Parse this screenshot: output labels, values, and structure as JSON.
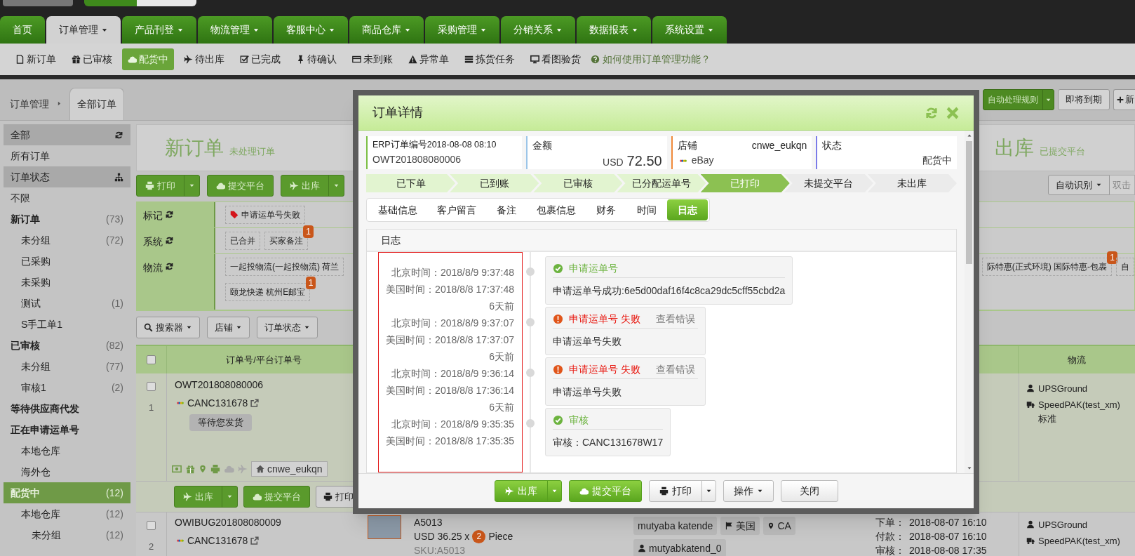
{
  "nav_tabs": [
    {
      "label": "首页",
      "dropdown": false,
      "selected": false
    },
    {
      "label": "订单管理",
      "dropdown": true,
      "selected": true
    },
    {
      "label": "产品刊登",
      "dropdown": true,
      "selected": false
    },
    {
      "label": "物流管理",
      "dropdown": true,
      "selected": false
    },
    {
      "label": "客服中心",
      "dropdown": true,
      "selected": false
    },
    {
      "label": "商品仓库",
      "dropdown": true,
      "selected": false
    },
    {
      "label": "采购管理",
      "dropdown": true,
      "selected": false
    },
    {
      "label": "分销关系",
      "dropdown": true,
      "selected": false
    },
    {
      "label": "数据报表",
      "dropdown": true,
      "selected": false
    },
    {
      "label": "系统设置",
      "dropdown": true,
      "selected": false
    }
  ],
  "sub_nav": {
    "items": [
      {
        "label": "新订单",
        "selected": false
      },
      {
        "label": "已审核",
        "selected": false
      },
      {
        "label": "配货中",
        "selected": true
      },
      {
        "label": "待出库",
        "selected": false
      },
      {
        "label": "已完成",
        "selected": false
      },
      {
        "label": "待确认",
        "selected": false
      },
      {
        "label": "未到账",
        "selected": false
      },
      {
        "label": "异常单",
        "selected": false
      },
      {
        "label": "拣货任务",
        "selected": false
      },
      {
        "label": "看图验货",
        "selected": false
      }
    ],
    "help": "如何使用订单管理功能？"
  },
  "breadcrumb": {
    "root": "订单管理",
    "tab": "全部订单"
  },
  "top_actions": [
    {
      "label": "自动处理规则",
      "kind": "split"
    },
    {
      "label": "即将到期",
      "kind": "plain"
    },
    {
      "label": "新",
      "kind": "add"
    }
  ],
  "sidebar": {
    "sections": [
      {
        "title": "全部",
        "items": [
          {
            "label": "所有订单",
            "kind": "plain",
            "selected": false
          }
        ]
      },
      {
        "title": "订单状态",
        "items": [
          {
            "label": "不限",
            "kind": "plain",
            "selected": false
          },
          {
            "label": "新订单",
            "count": "(73)",
            "kind": "group",
            "selected": false,
            "children": [
              {
                "label": "未分组",
                "count": "(72)",
                "selected": false
              },
              {
                "label": "已采购",
                "selected": false
              },
              {
                "label": "未采购",
                "selected": false
              },
              {
                "label": "测试",
                "count": "(1)",
                "selected": false
              },
              {
                "label": "S手工单1",
                "selected": false
              }
            ]
          },
          {
            "label": "已审核",
            "count": "(82)",
            "kind": "group",
            "selected": false,
            "children": [
              {
                "label": "未分组",
                "count": "(77)",
                "selected": false
              },
              {
                "label": "审核1",
                "count": "(2)",
                "selected": false
              }
            ]
          },
          {
            "label": "等待供应商代发",
            "kind": "group",
            "selected": false
          },
          {
            "label": "正在申请运单号",
            "kind": "group",
            "selected": false,
            "children": [
              {
                "label": "本地仓库",
                "selected": false
              },
              {
                "label": "海外仓",
                "selected": false
              }
            ]
          },
          {
            "label": "配货中",
            "count": "(12)",
            "kind": "group",
            "selected": true,
            "children": [
              {
                "label": "本地仓库",
                "count": "(12)",
                "selected": false,
                "children": [
                  {
                    "label": "未分组",
                    "count": "(12)",
                    "selected": false
                  }
                ]
              }
            ]
          }
        ]
      }
    ]
  },
  "summary": {
    "left": {
      "title": "新订单",
      "subtitle": "未处理订单"
    },
    "right": {
      "title": "出库",
      "subtitle": "已提交平台"
    }
  },
  "toolbar": {
    "buttons": [
      {
        "label": "打印",
        "kind": "split"
      },
      {
        "label": "提交平台",
        "kind": "plain"
      },
      {
        "label": "出库",
        "kind": "split"
      }
    ],
    "detect": "自动识别",
    "input_placeholder": "双击"
  },
  "filters": [
    {
      "label": "标记",
      "tags": [
        {
          "text": "申请运单号失败",
          "kind": "flag"
        }
      ]
    },
    {
      "label": "系统",
      "tags": [
        {
          "text": "已合并",
          "kind": "plain"
        },
        {
          "text": "买家备注",
          "kind": "plain",
          "badge": "1"
        }
      ]
    },
    {
      "label": "物流",
      "tags": [
        {
          "text": "一起投物流(一起投物流) 荷兰",
          "kind": "plain"
        },
        {
          "text": "颐龙快递 杭州E邮宝",
          "kind": "plain",
          "badge": "1"
        }
      ],
      "right_tags": [
        {
          "text": "际特惠(正式环境) 国际特惠-包裹",
          "badge": "1"
        },
        {
          "text": "自"
        }
      ]
    }
  ],
  "search_bar": [
    "搜索器",
    "店铺",
    "订单状态"
  ],
  "table": {
    "columns": [
      "订单号/平台订单号",
      "物流"
    ],
    "select_all_checked": false,
    "rows": [
      {
        "index": "1",
        "checked": false,
        "order_no": "OWT201808080006",
        "platform_no": "CANC131678",
        "status": "等待您发货",
        "shop": "cnwe_eukqn",
        "logistics": [
          "UPSGround",
          "SpeedPAK(test_xm) 标准"
        ],
        "actions": [
          {
            "label": "出库",
            "kind": "split"
          },
          {
            "label": "提交平台",
            "kind": "plain"
          },
          {
            "label": "打印",
            "kind": "white"
          }
        ]
      },
      {
        "index": "2",
        "checked": false,
        "order_no": "OWIBUG201808080009",
        "platform_no": "CANC131678",
        "product": {
          "name": "A5013",
          "price": "USD 36.25 x",
          "qty": "2",
          "unit": "Piece",
          "sku": "SKU:A5013"
        },
        "buyer": {
          "name": "mutyaba katende",
          "country": "美国",
          "region": "CA",
          "account": "mutyabkatend_0"
        },
        "dates": [
          {
            "label": "下单：",
            "value": "2018-08-07 16:10"
          },
          {
            "label": "付款：",
            "value": "2018-08-07 16:10"
          },
          {
            "label": "审核：",
            "value": "2018-08-08 17:35"
          }
        ],
        "logistics": [
          "UPSGround",
          "SpeedPAK(test_xm)"
        ]
      }
    ]
  },
  "modal": {
    "title": "订单详情",
    "cards": [
      {
        "kind": "id",
        "label": "ERP订单编号2018-08-08 08:10",
        "value": "OWT201808080006",
        "color": "#7cbf44"
      },
      {
        "kind": "amount",
        "label": "金额",
        "currency": "USD",
        "value": "72.50",
        "color": "#9cc5e8"
      },
      {
        "kind": "shop",
        "label": "店铺",
        "aside": "cnwe_eukqn",
        "value": "eBay",
        "color": "#f08a3a"
      },
      {
        "kind": "status",
        "label": "状态",
        "value": "配货中",
        "color": "#7b7be8"
      }
    ],
    "steps": [
      {
        "label": "已下单",
        "done": true,
        "selected": false
      },
      {
        "label": "已到账",
        "done": true,
        "selected": false
      },
      {
        "label": "已审核",
        "done": true,
        "selected": false
      },
      {
        "label": "已分配运单号",
        "done": true,
        "selected": false
      },
      {
        "label": "已打印",
        "done": true,
        "selected": true
      },
      {
        "label": "未提交平台",
        "done": false,
        "selected": false
      },
      {
        "label": "未出库",
        "done": false,
        "selected": false
      }
    ],
    "tabs": [
      {
        "label": "基础信息",
        "selected": false
      },
      {
        "label": "客户留言",
        "selected": false
      },
      {
        "label": "备注",
        "selected": false
      },
      {
        "label": "包裹信息",
        "selected": false
      },
      {
        "label": "财务",
        "selected": false
      },
      {
        "label": "时间",
        "selected": false
      },
      {
        "label": "日志",
        "selected": true
      }
    ],
    "log_title": "日志",
    "log": [
      {
        "beijing": "北京时间：2018/8/9 9:37:48",
        "us": "美国时间：2018/8/8 17:37:48",
        "ago": "6天前",
        "kind": "success",
        "title": "申请运单号",
        "body": "申请运单号成功:6e5d00daf16f4c8ca29dc5cff55cbd2a"
      },
      {
        "beijing": "北京时间：2018/8/9 9:37:07",
        "us": "美国时间：2018/8/8 17:37:07",
        "ago": "6天前",
        "kind": "error",
        "title": "申请运单号 失败",
        "link": "查看错误",
        "body": "申请运单号失败"
      },
      {
        "beijing": "北京时间：2018/8/9 9:36:14",
        "us": "美国时间：2018/8/8 17:36:14",
        "ago": "6天前",
        "kind": "error",
        "title": "申请运单号 失败",
        "link": "查看错误",
        "body": "申请运单号失败"
      },
      {
        "beijing": "北京时间：2018/8/9 9:35:35",
        "us": "美国时间：2018/8/8 17:35:35",
        "kind": "success",
        "title": "审核",
        "body": "审核：CANC131678W17"
      }
    ],
    "footer": [
      {
        "label": "出库",
        "kind": "green-split"
      },
      {
        "label": "提交平台",
        "kind": "green"
      },
      {
        "label": "打印",
        "kind": "white-split"
      },
      {
        "label": "操作",
        "kind": "dropdown"
      },
      {
        "label": "关闭",
        "kind": "white"
      }
    ]
  }
}
